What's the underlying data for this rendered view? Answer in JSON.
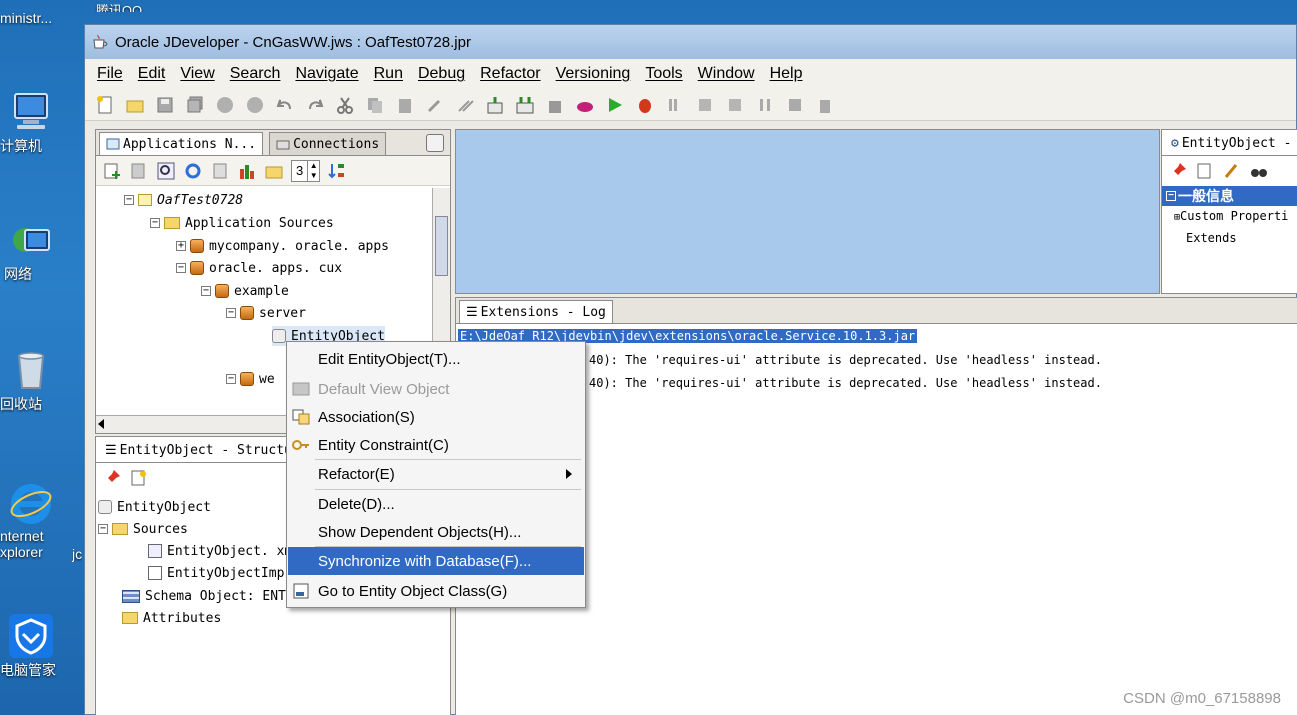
{
  "desktop": {
    "icons": [
      {
        "label": "ministr..."
      },
      {
        "label": "腾讯QQ"
      },
      {
        "label": "计算机"
      },
      {
        "label": "网络"
      },
      {
        "label": "回收站"
      },
      {
        "label_line1": "nternet",
        "label_line2": "xplorer"
      },
      {
        "label": "电脑管家"
      },
      {
        "label": "jc"
      }
    ]
  },
  "window": {
    "title": "Oracle JDeveloper - CnGasWW.jws : OafTest0728.jpr"
  },
  "menu": [
    "File",
    "Edit",
    "View",
    "Search",
    "Navigate",
    "Run",
    "Debug",
    "Refactor",
    "Versioning",
    "Tools",
    "Window",
    "Help"
  ],
  "app_nav": {
    "tabs": [
      "Applications N...",
      "Connections"
    ],
    "spinner_value": "3",
    "tree": [
      {
        "label": "OafTest0728",
        "expander": "−"
      },
      {
        "label": "Application Sources",
        "expander": "−"
      },
      {
        "label": "mycompany. oracle. apps",
        "expander": "+"
      },
      {
        "label": "oracle. apps. cux",
        "expander": "−"
      },
      {
        "label": "example",
        "expander": "−"
      },
      {
        "label": "server",
        "expander": "−"
      },
      {
        "label": "EntityObject"
      },
      {
        "label": "we"
      }
    ]
  },
  "structure": {
    "tab": "EntityObject - Structu",
    "tree": [
      {
        "label": "EntityObject"
      },
      {
        "label": "Sources",
        "expander": "−"
      },
      {
        "label": "EntityObject. xml"
      },
      {
        "label": "EntityObjectImp"
      },
      {
        "label": "Schema Object: ENTI"
      },
      {
        "label": "Attributes"
      }
    ]
  },
  "log": {
    "tab": "Extensions - Log",
    "path": "E:\\JdeOaf_R12\\jdevbin\\jdev\\extensions\\oracle.Service.10.1.3.jar",
    "lines": [
      "40): The 'requires-ui' attribute is deprecated. Use 'headless' instead.",
      "40): The 'requires-ui' attribute is deprecated. Use 'headless' instead."
    ]
  },
  "properties": {
    "tab": "EntityObject -",
    "section": "一般信息",
    "rows": [
      "Custom Properti",
      "Extends"
    ]
  },
  "context_menu": {
    "items": [
      {
        "label": "Edit EntityObject(T)...",
        "state": "normal"
      },
      {
        "label": "Default View Object",
        "state": "disabled"
      },
      {
        "label": "Association(S)",
        "state": "normal"
      },
      {
        "label": "Entity Constraint(C)",
        "state": "normal"
      },
      {
        "label": "Refactor(E)",
        "state": "normal",
        "submenu": true
      },
      {
        "label": "Delete(D)...",
        "state": "normal"
      },
      {
        "label": "Show Dependent Objects(H)...",
        "state": "normal"
      },
      {
        "label": "Synchronize with Database(F)...",
        "state": "selected"
      },
      {
        "label": "Go to Entity Object Class(G)",
        "state": "normal"
      }
    ]
  },
  "watermark": "CSDN @m0_67158898",
  "colors": {
    "selection": "#316ac5",
    "editor_bg": "#a8c8ec"
  }
}
